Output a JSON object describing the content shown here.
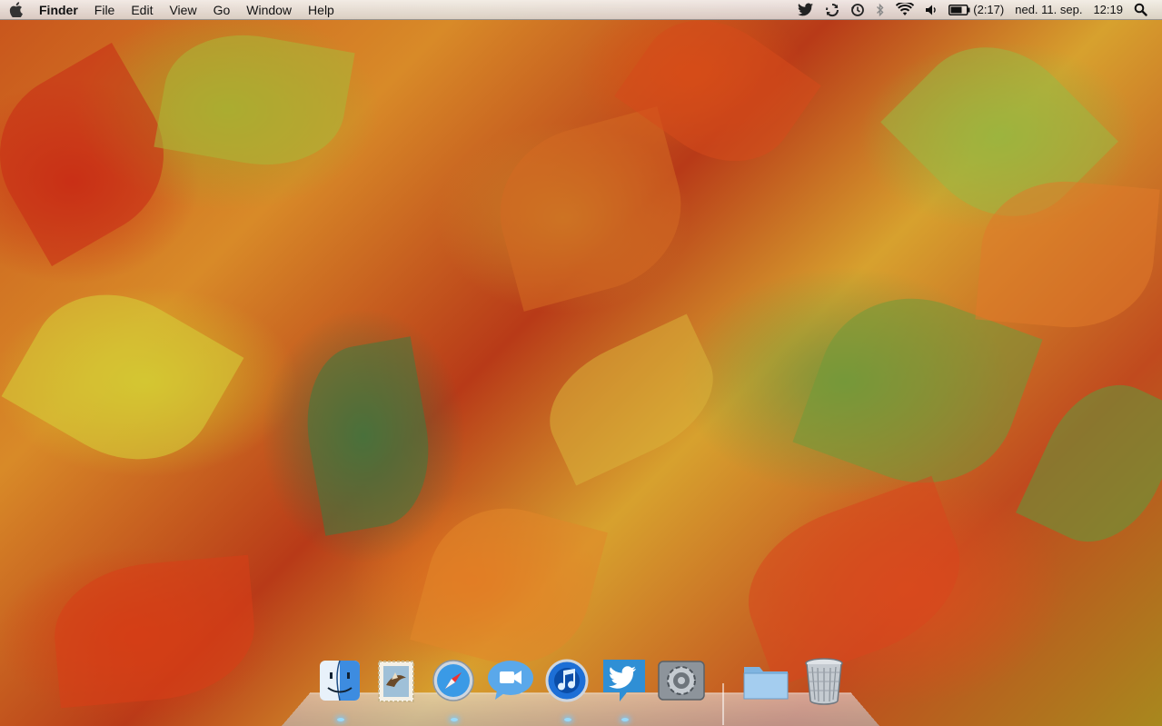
{
  "menubar": {
    "apple_icon": "apple-icon",
    "items": [
      "Finder",
      "File",
      "Edit",
      "View",
      "Go",
      "Window",
      "Help"
    ],
    "status": {
      "battery_time": "(2:17)",
      "date": "ned. 11. sep.",
      "time": "12:19"
    }
  },
  "dock": {
    "apps": [
      "Finder",
      "Mail",
      "Safari",
      "FaceTime",
      "iTunes",
      "Twitter",
      "System Preferences"
    ],
    "stack": "Documents",
    "trash": "Trash"
  },
  "colors": {
    "menubar": "#e8e8e8",
    "dock_indicator": "#96dcff"
  }
}
